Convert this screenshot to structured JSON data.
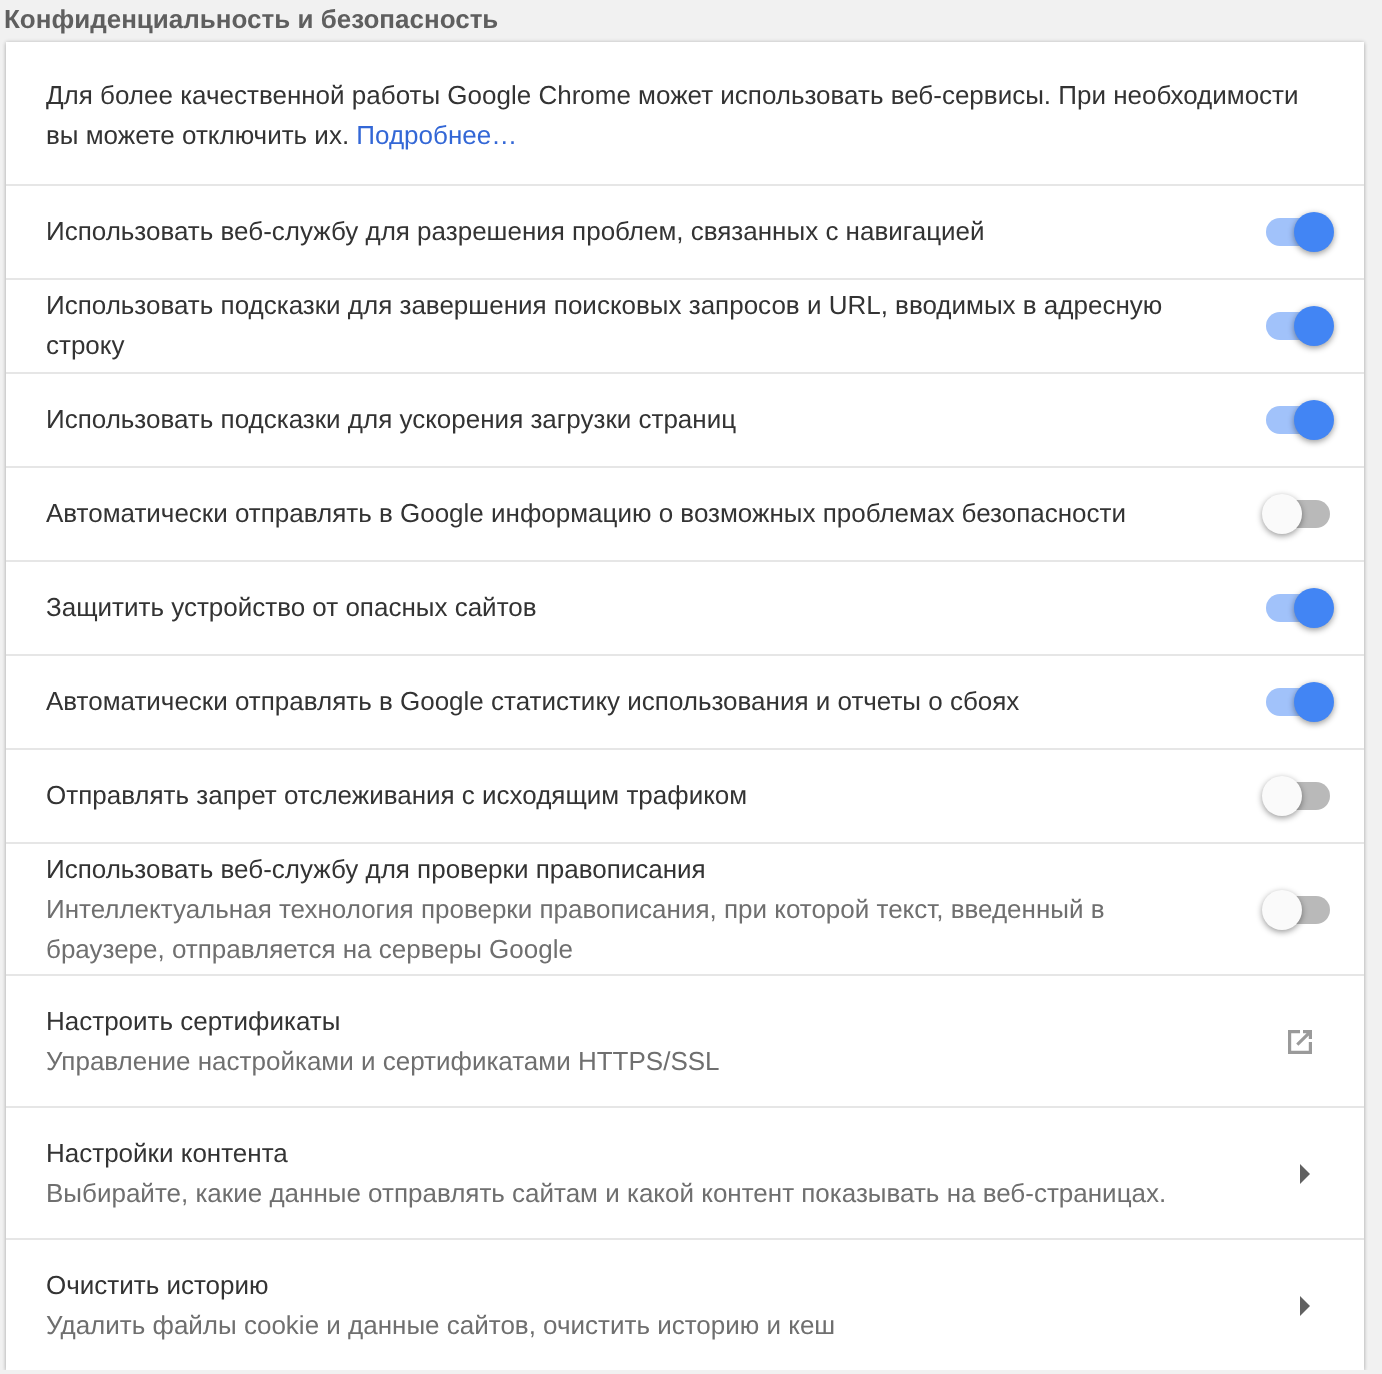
{
  "section": {
    "title": "Конфиденциальность и безопасность"
  },
  "intro": {
    "text": "Для более качественной работы Google Chrome может использовать веб-сервисы. При необходимости вы можете отключить их.",
    "link": "Подробнее…"
  },
  "rows": [
    {
      "kind": "toggle",
      "label": "Использовать веб-службу для разрешения проблем, связанных с навигацией",
      "on": true
    },
    {
      "kind": "toggle",
      "label": "Использовать подсказки для завершения поисковых запросов и URL, вводимых в адресную строку",
      "on": true
    },
    {
      "kind": "toggle",
      "label": "Использовать подсказки для ускорения загрузки страниц",
      "on": true
    },
    {
      "kind": "toggle",
      "label": "Автоматически отправлять в Google информацию о возможных проблемах безопасности",
      "on": false
    },
    {
      "kind": "toggle",
      "label": "Защитить устройство от опасных сайтов",
      "on": true
    },
    {
      "kind": "toggle",
      "label": "Автоматически отправлять в Google статистику использования и отчеты о сбоях",
      "on": true
    },
    {
      "kind": "toggle",
      "label": "Отправлять запрет отслеживания с исходящим трафиком",
      "on": false
    },
    {
      "kind": "toggle",
      "label": "Использовать веб-службу для проверки правописания",
      "description": "Интеллектуальная технология проверки правописания, при которой текст, введенный в браузере, отправляется на серверы Google",
      "on": false
    },
    {
      "kind": "external",
      "label": "Настроить сертификаты",
      "description": "Управление настройками и сертификатами HTTPS/SSL"
    },
    {
      "kind": "arrow",
      "label": "Настройки контента",
      "description": "Выбирайте, какие данные отправлять сайтам и какой контент показывать на веб-страницах."
    },
    {
      "kind": "arrow",
      "label": "Очистить историю",
      "description": "Удалить файлы cookie и данные сайтов, очистить историю и кеш"
    }
  ]
}
